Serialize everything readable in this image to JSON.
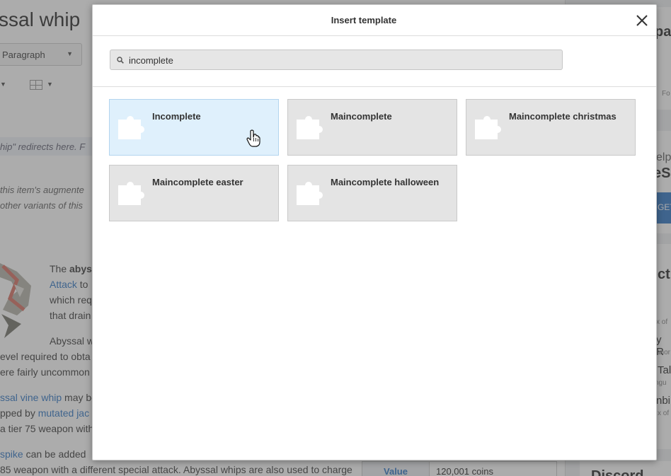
{
  "background": {
    "page_title": "ssal whip",
    "format_select": "Paragraph",
    "hatnote": "hip\" redirects here. F",
    "italic_note_1": " this item's augmente",
    "italic_note_2": " other variants of this",
    "para1": {
      "l1_pre": "The ",
      "l1_bold": "abys",
      "l2_link": "Attack",
      "l2_rest": " to",
      "l3": "which req",
      "l4": "that drain"
    },
    "para2": {
      "l1": "Abyssal w",
      "l2": "evel required to obta",
      "l3": "ere fairly uncommon"
    },
    "para3": {
      "l1_link": "ssal vine whip",
      "l1_rest": " may be",
      "l2_pre": "pped by ",
      "l2_link": "mutated jac",
      "l3": "a tier 75 weapon with"
    },
    "para4": {
      "l1_link": "spike",
      "l1_rest": " can be added",
      "l2": "85 weapon with a different special attack. Abyssal whips are also used to charge"
    },
    "infobox": {
      "key": "Value",
      "value": "120,001 coins"
    },
    "right_rail": {
      "t1": "pa",
      "t2": "elp",
      "t3": "eS",
      "get": "GET",
      "t4": "cti",
      "s1": "x of",
      "t5": "y R",
      "s2": "anor",
      "t6": "Tal",
      "s3": "ngu",
      "t7": "nbi",
      "s4": "x of",
      "t8": "Discord",
      "fo": "Fo"
    }
  },
  "modal": {
    "title": "Insert template",
    "search": {
      "value": "incomplete",
      "placeholder": ""
    },
    "results": [
      {
        "label": "Incomplete",
        "selected": true
      },
      {
        "label": "Maincomplete",
        "selected": false
      },
      {
        "label": "Maincomplete christmas",
        "selected": false
      },
      {
        "label": "Maincomplete easter",
        "selected": false
      },
      {
        "label": "Maincomplete halloween",
        "selected": false
      }
    ],
    "icons": {
      "close": "close-icon",
      "search": "search-icon",
      "tile": "puzzle-piece-icon"
    }
  },
  "colors": {
    "selected_tile": "#dff0fc",
    "tile": "#e4e4e4",
    "link": "#3a7cc7",
    "overlay": "rgba(70,70,70,0.45)"
  }
}
